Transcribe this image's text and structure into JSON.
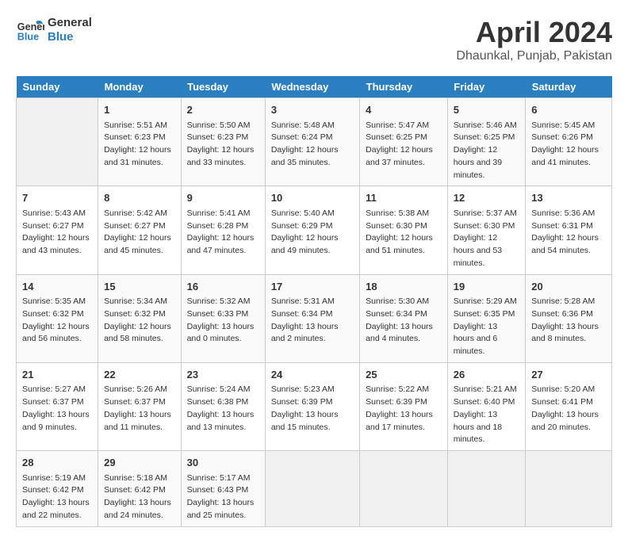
{
  "header": {
    "logo_general": "General",
    "logo_blue": "Blue",
    "month_title": "April 2024",
    "location": "Dhaunkal, Punjab, Pakistan"
  },
  "weekdays": [
    "Sunday",
    "Monday",
    "Tuesday",
    "Wednesday",
    "Thursday",
    "Friday",
    "Saturday"
  ],
  "weeks": [
    [
      {
        "day": "",
        "sunrise": "",
        "sunset": "",
        "daylight": ""
      },
      {
        "day": "1",
        "sunrise": "Sunrise: 5:51 AM",
        "sunset": "Sunset: 6:23 PM",
        "daylight": "Daylight: 12 hours and 31 minutes."
      },
      {
        "day": "2",
        "sunrise": "Sunrise: 5:50 AM",
        "sunset": "Sunset: 6:23 PM",
        "daylight": "Daylight: 12 hours and 33 minutes."
      },
      {
        "day": "3",
        "sunrise": "Sunrise: 5:48 AM",
        "sunset": "Sunset: 6:24 PM",
        "daylight": "Daylight: 12 hours and 35 minutes."
      },
      {
        "day": "4",
        "sunrise": "Sunrise: 5:47 AM",
        "sunset": "Sunset: 6:25 PM",
        "daylight": "Daylight: 12 hours and 37 minutes."
      },
      {
        "day": "5",
        "sunrise": "Sunrise: 5:46 AM",
        "sunset": "Sunset: 6:25 PM",
        "daylight": "Daylight: 12 hours and 39 minutes."
      },
      {
        "day": "6",
        "sunrise": "Sunrise: 5:45 AM",
        "sunset": "Sunset: 6:26 PM",
        "daylight": "Daylight: 12 hours and 41 minutes."
      }
    ],
    [
      {
        "day": "7",
        "sunrise": "Sunrise: 5:43 AM",
        "sunset": "Sunset: 6:27 PM",
        "daylight": "Daylight: 12 hours and 43 minutes."
      },
      {
        "day": "8",
        "sunrise": "Sunrise: 5:42 AM",
        "sunset": "Sunset: 6:27 PM",
        "daylight": "Daylight: 12 hours and 45 minutes."
      },
      {
        "day": "9",
        "sunrise": "Sunrise: 5:41 AM",
        "sunset": "Sunset: 6:28 PM",
        "daylight": "Daylight: 12 hours and 47 minutes."
      },
      {
        "day": "10",
        "sunrise": "Sunrise: 5:40 AM",
        "sunset": "Sunset: 6:29 PM",
        "daylight": "Daylight: 12 hours and 49 minutes."
      },
      {
        "day": "11",
        "sunrise": "Sunrise: 5:38 AM",
        "sunset": "Sunset: 6:30 PM",
        "daylight": "Daylight: 12 hours and 51 minutes."
      },
      {
        "day": "12",
        "sunrise": "Sunrise: 5:37 AM",
        "sunset": "Sunset: 6:30 PM",
        "daylight": "Daylight: 12 hours and 53 minutes."
      },
      {
        "day": "13",
        "sunrise": "Sunrise: 5:36 AM",
        "sunset": "Sunset: 6:31 PM",
        "daylight": "Daylight: 12 hours and 54 minutes."
      }
    ],
    [
      {
        "day": "14",
        "sunrise": "Sunrise: 5:35 AM",
        "sunset": "Sunset: 6:32 PM",
        "daylight": "Daylight: 12 hours and 56 minutes."
      },
      {
        "day": "15",
        "sunrise": "Sunrise: 5:34 AM",
        "sunset": "Sunset: 6:32 PM",
        "daylight": "Daylight: 12 hours and 58 minutes."
      },
      {
        "day": "16",
        "sunrise": "Sunrise: 5:32 AM",
        "sunset": "Sunset: 6:33 PM",
        "daylight": "Daylight: 13 hours and 0 minutes."
      },
      {
        "day": "17",
        "sunrise": "Sunrise: 5:31 AM",
        "sunset": "Sunset: 6:34 PM",
        "daylight": "Daylight: 13 hours and 2 minutes."
      },
      {
        "day": "18",
        "sunrise": "Sunrise: 5:30 AM",
        "sunset": "Sunset: 6:34 PM",
        "daylight": "Daylight: 13 hours and 4 minutes."
      },
      {
        "day": "19",
        "sunrise": "Sunrise: 5:29 AM",
        "sunset": "Sunset: 6:35 PM",
        "daylight": "Daylight: 13 hours and 6 minutes."
      },
      {
        "day": "20",
        "sunrise": "Sunrise: 5:28 AM",
        "sunset": "Sunset: 6:36 PM",
        "daylight": "Daylight: 13 hours and 8 minutes."
      }
    ],
    [
      {
        "day": "21",
        "sunrise": "Sunrise: 5:27 AM",
        "sunset": "Sunset: 6:37 PM",
        "daylight": "Daylight: 13 hours and 9 minutes."
      },
      {
        "day": "22",
        "sunrise": "Sunrise: 5:26 AM",
        "sunset": "Sunset: 6:37 PM",
        "daylight": "Daylight: 13 hours and 11 minutes."
      },
      {
        "day": "23",
        "sunrise": "Sunrise: 5:24 AM",
        "sunset": "Sunset: 6:38 PM",
        "daylight": "Daylight: 13 hours and 13 minutes."
      },
      {
        "day": "24",
        "sunrise": "Sunrise: 5:23 AM",
        "sunset": "Sunset: 6:39 PM",
        "daylight": "Daylight: 13 hours and 15 minutes."
      },
      {
        "day": "25",
        "sunrise": "Sunrise: 5:22 AM",
        "sunset": "Sunset: 6:39 PM",
        "daylight": "Daylight: 13 hours and 17 minutes."
      },
      {
        "day": "26",
        "sunrise": "Sunrise: 5:21 AM",
        "sunset": "Sunset: 6:40 PM",
        "daylight": "Daylight: 13 hours and 18 minutes."
      },
      {
        "day": "27",
        "sunrise": "Sunrise: 5:20 AM",
        "sunset": "Sunset: 6:41 PM",
        "daylight": "Daylight: 13 hours and 20 minutes."
      }
    ],
    [
      {
        "day": "28",
        "sunrise": "Sunrise: 5:19 AM",
        "sunset": "Sunset: 6:42 PM",
        "daylight": "Daylight: 13 hours and 22 minutes."
      },
      {
        "day": "29",
        "sunrise": "Sunrise: 5:18 AM",
        "sunset": "Sunset: 6:42 PM",
        "daylight": "Daylight: 13 hours and 24 minutes."
      },
      {
        "day": "30",
        "sunrise": "Sunrise: 5:17 AM",
        "sunset": "Sunset: 6:43 PM",
        "daylight": "Daylight: 13 hours and 25 minutes."
      },
      {
        "day": "",
        "sunrise": "",
        "sunset": "",
        "daylight": ""
      },
      {
        "day": "",
        "sunrise": "",
        "sunset": "",
        "daylight": ""
      },
      {
        "day": "",
        "sunrise": "",
        "sunset": "",
        "daylight": ""
      },
      {
        "day": "",
        "sunrise": "",
        "sunset": "",
        "daylight": ""
      }
    ]
  ]
}
